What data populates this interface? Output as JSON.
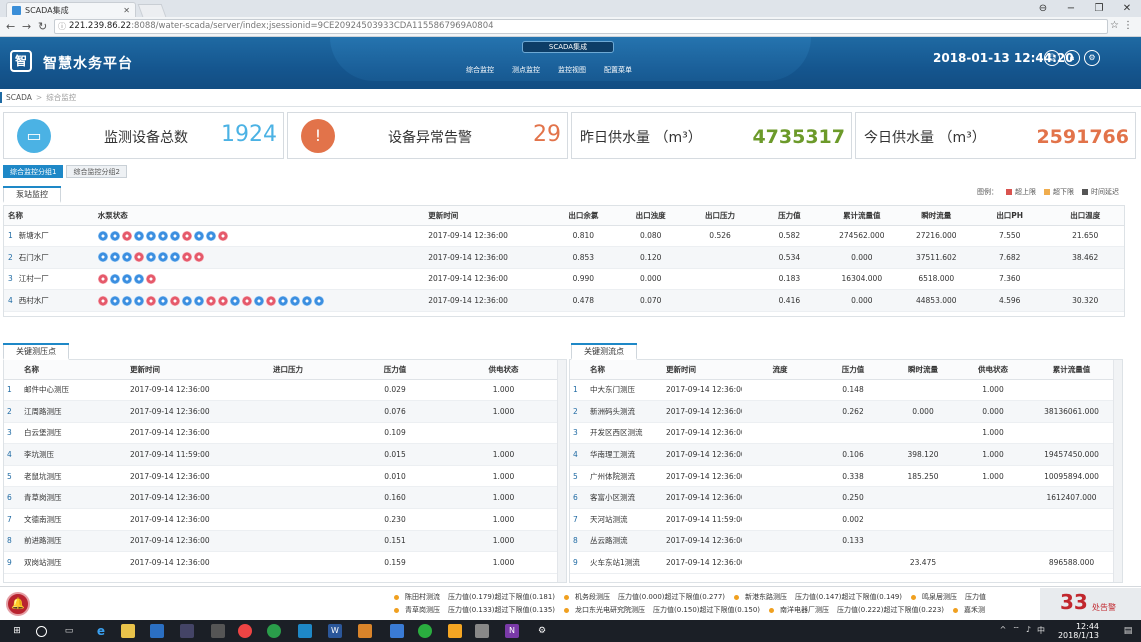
{
  "browser": {
    "tab_title": "SCADA集成",
    "url_host": "221.239.86.22",
    "url_rest": ":8088/water-scada/server/index;jsessionid=9CE20924503933CDA1155867969A0804",
    "win_minimize": "−",
    "win_restore": "❐",
    "win_close": "✕",
    "user_icon": "person-icon"
  },
  "header": {
    "logo_glyph": "智",
    "brand": "智慧水务平台",
    "center_pill": "SCADA集成",
    "nav": [
      "综合监控",
      "测点监控",
      "监控视图",
      "配置菜单"
    ],
    "datetime": "2018-01-13 12:44:20",
    "icons": [
      "user-icon",
      "home-icon",
      "settings-icon"
    ]
  },
  "breadcrumb": {
    "root": "SCADA",
    "separator": ">",
    "current": "综合监控"
  },
  "stats": [
    {
      "label": "监测设备总数",
      "value": "1924",
      "color": "#4bb2e4",
      "icon": "device-icon"
    },
    {
      "label": "设备异常告警",
      "value": "29",
      "color": "#e2734a",
      "icon": "warning-icon"
    },
    {
      "label": "昨日供水量 （m³）",
      "value": "4735317",
      "color": "#6c9a2a"
    },
    {
      "label": "今日供水量 （m³）",
      "value": "2591766",
      "color": "#e2734a"
    }
  ],
  "group_tabs": [
    "综合监控分组1",
    "综合监控分组2"
  ],
  "pump_panel": {
    "tab": "泵站监控",
    "legend": [
      {
        "label": "超上限",
        "color": "#d9534f"
      },
      {
        "label": "超下限",
        "color": "#f0ad4e"
      },
      {
        "label": "时间延迟",
        "color": "#555555"
      }
    ],
    "legend_title": "图例：",
    "columns": [
      "名称",
      "水泵状态",
      "更新时间",
      "出口余氯",
      "出口浊度",
      "出口压力",
      "压力值",
      "累计流量值",
      "瞬时流量",
      "出口PH",
      "出口温度"
    ],
    "rows": [
      {
        "idx": "1",
        "name": "新塘水厂",
        "pumps": [
          1,
          1,
          0,
          1,
          1,
          1,
          1,
          0,
          1,
          1,
          0
        ],
        "time": "2017-09-14 12:36:00",
        "v": [
          "0.810",
          "0.080",
          "0.526",
          "0.582",
          "274562.000",
          "27216.000",
          "7.550",
          "21.650"
        ]
      },
      {
        "idx": "2",
        "name": "石门水厂",
        "pumps": [
          1,
          1,
          1,
          0,
          1,
          1,
          1,
          0,
          0
        ],
        "time": "2017-09-14 12:36:00",
        "v": [
          "0.853",
          "0.120",
          "",
          "0.534",
          "0.000",
          "37511.602",
          "7.682",
          "38.462"
        ]
      },
      {
        "idx": "3",
        "name": "江村一厂",
        "pumps": [
          0,
          1,
          1,
          1,
          0
        ],
        "time": "2017-09-14 12:36:00",
        "v": [
          "0.990",
          "0.000",
          "",
          "0.183",
          "16304.000",
          "6518.000",
          "7.360",
          ""
        ]
      },
      {
        "idx": "4",
        "name": "西村水厂",
        "pumps": [
          0,
          1,
          1,
          1,
          0,
          1,
          0,
          1,
          1,
          0,
          0,
          1,
          0,
          1,
          0,
          1,
          1,
          1,
          1
        ],
        "time": "2017-09-14 12:36:00",
        "v": [
          "0.478",
          "0.070",
          "",
          "0.416",
          "0.000",
          "44853.000",
          "4.596",
          "30.320"
        ]
      }
    ]
  },
  "pressure_panel": {
    "tab": "关键测压点",
    "columns": [
      "名称",
      "更新时间",
      "进口压力",
      "压力值",
      "供电状态"
    ],
    "rows": [
      [
        "1",
        "邮件中心测压",
        "2017-09-14 12:36:00",
        "",
        "0.029",
        "1.000"
      ],
      [
        "2",
        "江周路测压",
        "2017-09-14 12:36:00",
        "",
        "0.076",
        "1.000"
      ],
      [
        "3",
        "白云堡测压",
        "2017-09-14 12:36:00",
        "",
        "0.109",
        ""
      ],
      [
        "4",
        "李坑测压",
        "2017-09-14 11:59:00",
        "",
        "0.015",
        "1.000"
      ],
      [
        "5",
        "老鼠坑测压",
        "2017-09-14 12:36:00",
        "",
        "0.010",
        "1.000"
      ],
      [
        "6",
        "青草岗测压",
        "2017-09-14 12:36:00",
        "",
        "0.160",
        "1.000"
      ],
      [
        "7",
        "文德南测压",
        "2017-09-14 12:36:00",
        "",
        "0.230",
        "1.000"
      ],
      [
        "8",
        "前进路测压",
        "2017-09-14 12:36:00",
        "",
        "0.151",
        "1.000"
      ],
      [
        "9",
        "双岗站测压",
        "2017-09-14 12:36:00",
        "",
        "0.159",
        "1.000"
      ]
    ]
  },
  "flow_panel": {
    "tab": "关键测流点",
    "columns": [
      "名称",
      "更新时间",
      "流度",
      "压力值",
      "瞬时流量",
      "供电状态",
      "累计流量值"
    ],
    "rows": [
      [
        "1",
        "中大东门测压",
        "2017-09-14 12:36:00",
        "",
        "0.148",
        "",
        "1.000",
        ""
      ],
      [
        "2",
        "新洲码头测流",
        "2017-09-14 12:36:00",
        "",
        "0.262",
        "0.000",
        "0.000",
        "38136061.000"
      ],
      [
        "3",
        "开发区西区测流",
        "2017-09-14 12:36:00",
        "",
        "",
        "",
        "1.000",
        ""
      ],
      [
        "4",
        "华南理工测流",
        "2017-09-14 12:36:00",
        "",
        "0.106",
        "398.120",
        "1.000",
        "19457450.000"
      ],
      [
        "5",
        "广州体院测流",
        "2017-09-14 12:36:00",
        "",
        "0.338",
        "185.250",
        "1.000",
        "10095894.000"
      ],
      [
        "6",
        "客富小区测流",
        "2017-09-14 12:36:00",
        "",
        "0.250",
        "",
        "",
        "1612407.000"
      ],
      [
        "7",
        "天河站测流",
        "2017-09-14 11:59:00",
        "",
        "0.002",
        "",
        "",
        ""
      ],
      [
        "8",
        "丛云路测流",
        "2017-09-14 12:36:00",
        "",
        "0.133",
        "",
        "",
        ""
      ],
      [
        "9",
        "火车东站1测流",
        "2017-09-14 12:36:00",
        "",
        "",
        "23.475",
        "",
        "896588.000"
      ]
    ]
  },
  "alarm_bar": {
    "line1": [
      {
        "n": "陈田村测流",
        "m": "压力值(0.179)超过下限值(0.181)"
      },
      {
        "n": "机务段测压",
        "m": "压力值(0.000)超过下限值(0.277)"
      },
      {
        "n": "新港东路测压",
        "m": "压力值(0.147)超过下限值(0.149)"
      },
      {
        "n": "鸣泉居测压",
        "m": "压力值"
      }
    ],
    "line2": [
      {
        "n": "青草岗测压",
        "m": "压力值(0.133)超过下限值(0.135)"
      },
      {
        "n": "龙口东光电研究院测压",
        "m": "压力值(0.150)超过下限值(0.150)"
      },
      {
        "n": "南洋电器厂测压",
        "m": "压力值(0.222)超过下限值(0.223)"
      },
      {
        "n": "嘉禾测",
        "m": ""
      }
    ],
    "count": "33",
    "count_label": "处告警"
  },
  "taskbar": {
    "time": "12:44",
    "date": "2018/1/13",
    "ime": "中"
  }
}
